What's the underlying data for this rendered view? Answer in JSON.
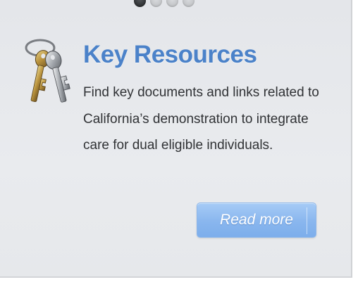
{
  "carousel": {
    "dots": [
      {
        "name": "carousel-dot-1",
        "active": true
      },
      {
        "name": "carousel-dot-2",
        "active": false
      },
      {
        "name": "carousel-dot-3",
        "active": false
      },
      {
        "name": "carousel-dot-4",
        "active": false
      }
    ]
  },
  "card": {
    "icon": "keys-icon",
    "title": "Key Resources",
    "description": "Find key documents and links related to California’s demonstration to integrate care for dual eligible individuals.",
    "button_label": "Read more"
  },
  "colors": {
    "title": "#4b82c9",
    "button": "#89b6ee",
    "panel": "#e6e8eb"
  }
}
